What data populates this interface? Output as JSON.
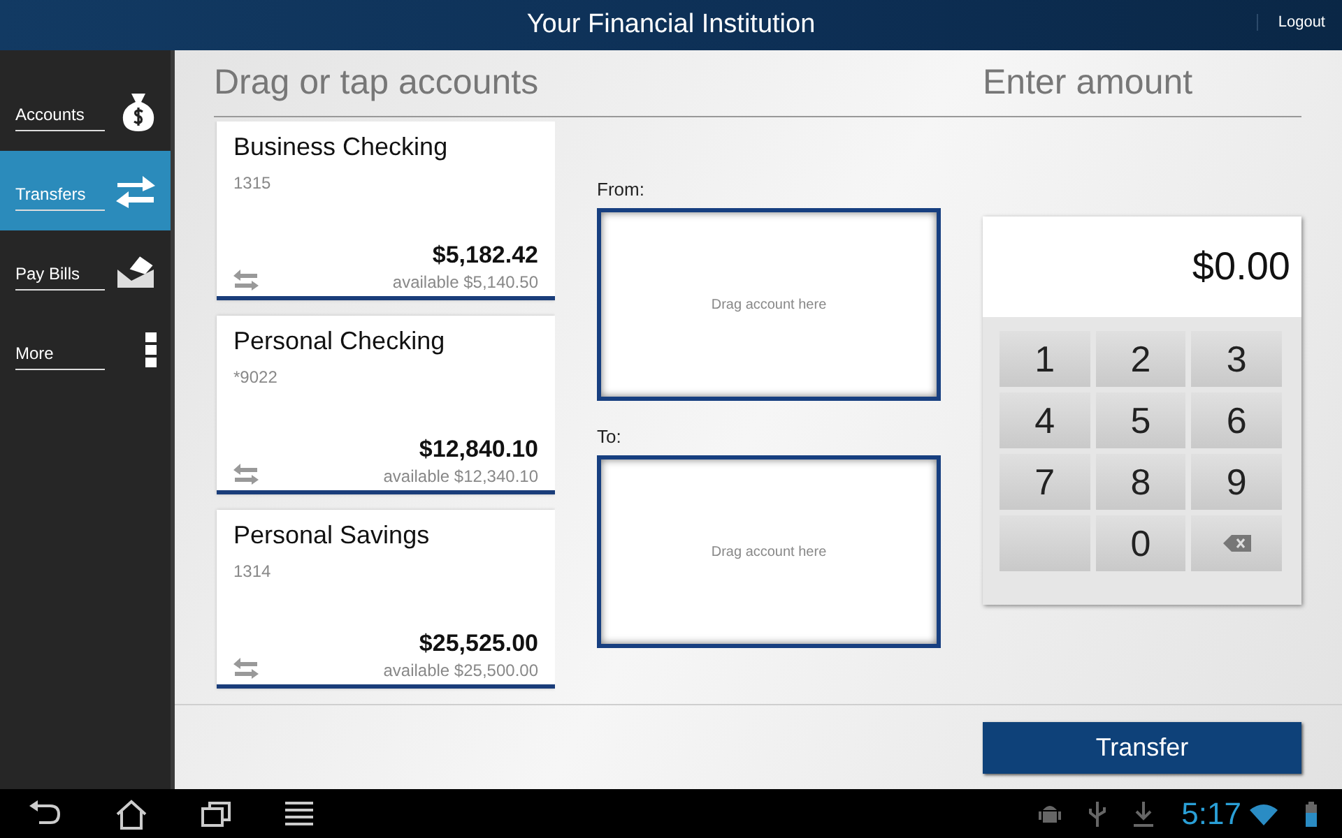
{
  "header": {
    "title": "Your Financial Institution",
    "logout": "Logout"
  },
  "sidebar": {
    "items": [
      {
        "label": "Accounts",
        "selected": false
      },
      {
        "label": "Transfers",
        "selected": true
      },
      {
        "label": "Pay Bills",
        "selected": false
      },
      {
        "label": "More",
        "selected": false
      }
    ]
  },
  "accounts_heading": "Drag or tap accounts",
  "amount_heading": "Enter amount",
  "accounts": [
    {
      "name": "Business Checking",
      "number": "1315",
      "balance": "$5,182.42",
      "available": "available $5,140.50"
    },
    {
      "name": "Personal Checking",
      "number": "*9022",
      "balance": "$12,840.10",
      "available": "available $12,340.10"
    },
    {
      "name": "Personal Savings",
      "number": "1314",
      "balance": "$25,525.00",
      "available": "available $25,500.00"
    }
  ],
  "drop_zones": [
    {
      "label": "From:",
      "placeholder": "Drag account here"
    },
    {
      "label": "To:",
      "placeholder": "Drag account here"
    }
  ],
  "amount": "$0.00",
  "keypad": [
    {
      "kind": "digit",
      "label": "1"
    },
    {
      "kind": "digit",
      "label": "2"
    },
    {
      "kind": "digit",
      "label": "3"
    },
    {
      "kind": "digit",
      "label": "4"
    },
    {
      "kind": "digit",
      "label": "5"
    },
    {
      "kind": "digit",
      "label": "6"
    },
    {
      "kind": "digit",
      "label": "7"
    },
    {
      "kind": "digit",
      "label": "8"
    },
    {
      "kind": "digit",
      "label": "9"
    },
    {
      "kind": "blank"
    },
    {
      "kind": "digit",
      "label": "0"
    },
    {
      "kind": "backspace"
    }
  ],
  "transfer_button": "Transfer",
  "system_bar": {
    "time": "5:17"
  }
}
